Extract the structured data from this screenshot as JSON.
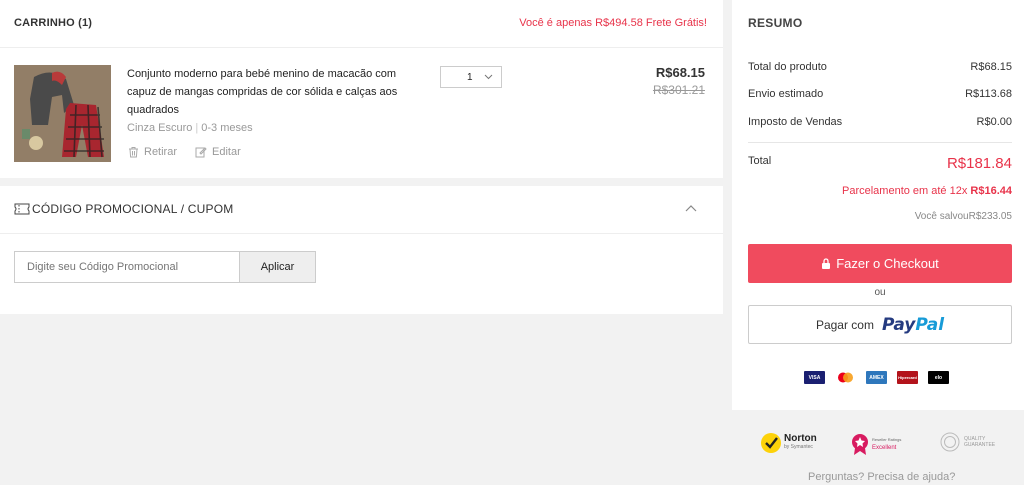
{
  "cart": {
    "title": "CARRINHO (1)",
    "free_shipping_notice": "Você é apenas R$494.58 Frete Grátis!",
    "item": {
      "name": "Conjunto moderno para bebé menino de macacão com capuz de mangas compridas de cor sólida e calças aos quadrados",
      "color": "Cinza Escuro",
      "size": "0-3 meses",
      "quantity": "1",
      "price": "R$68.15",
      "original_price": "R$301.21",
      "remove_label": "Retirar",
      "edit_label": "Editar"
    }
  },
  "coupon": {
    "title": "CÓDIGO PROMOCIONAL / CUPOM",
    "placeholder": "Digite seu Código Promocional",
    "apply_label": "Aplicar"
  },
  "summary": {
    "title": "RESUMO",
    "rows": [
      {
        "label": "Total do produto",
        "value": "R$68.15"
      },
      {
        "label": "Envio estimado",
        "value": "R$113.68"
      },
      {
        "label": "Imposto de Vendas",
        "value": "R$0.00"
      }
    ],
    "total_label": "Total",
    "total_value": "R$181.84",
    "installment_text": "Parcelamento em até 12x ",
    "installment_value": "R$16.44",
    "saved_label": "Você salvou",
    "saved_value": "R$233.05",
    "checkout_label": "Fazer o Checkout",
    "or_label": "ou",
    "paypal_prefix": "Pagar com",
    "paypal_pay": "Pay",
    "paypal_pal": "Pal",
    "cards": [
      "VISA",
      "mastercard",
      "AMEX",
      "Hipercard",
      "elo"
    ]
  },
  "badges": {
    "norton": "Norton",
    "norton_sub": "by Symantec",
    "reseller": "Reseller Ratings",
    "reseller_sub": "Excellent",
    "quality": "QUALITY GUARANTEE"
  },
  "help_text": "Perguntas? Precisa de ajuda?",
  "colors": {
    "accent": "#f04b5e",
    "price_red": "#e8334a"
  }
}
